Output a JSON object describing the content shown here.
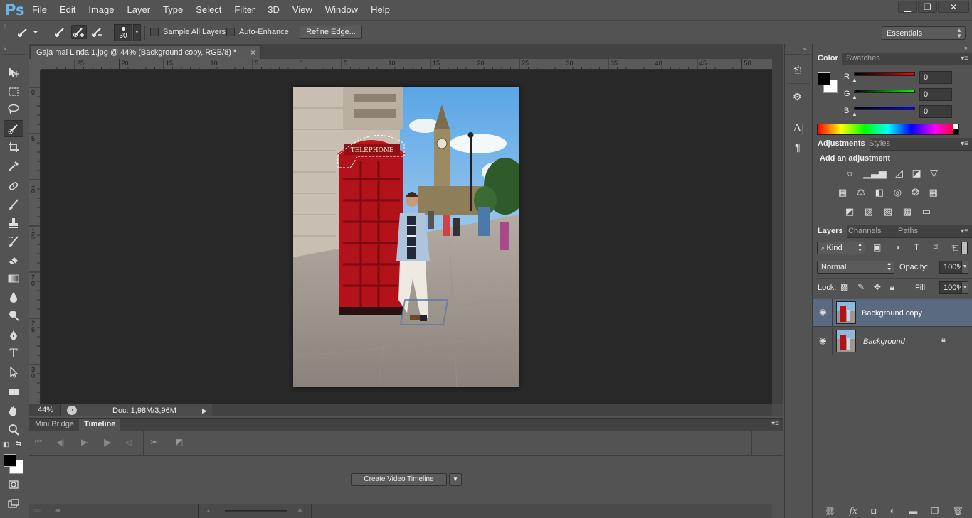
{
  "app": {
    "logo": "Ps"
  },
  "menu": [
    "File",
    "Edit",
    "Image",
    "Layer",
    "Type",
    "Select",
    "Filter",
    "3D",
    "View",
    "Window",
    "Help"
  ],
  "window_controls": {
    "minimize": "▁",
    "restore": "❐",
    "close": "✕"
  },
  "options": {
    "brush_size": "30",
    "sample_all_layers": "Sample All Layers",
    "auto_enhance": "Auto-Enhance",
    "refine_edge": "Refine Edge...",
    "workspace": "Essentials"
  },
  "document": {
    "tab_title": "Gaja mai Linda 1.jpg @ 44% (Background copy, RGB/8) *",
    "close": "×",
    "zoom": "44%",
    "doc_info": "Doc: 1,98M/3,96M",
    "ruler_top": [
      "25",
      "20",
      "15",
      "10",
      "5",
      "0",
      "5",
      "10",
      "15",
      "20",
      "25",
      "30",
      "35",
      "40",
      "45",
      "50"
    ],
    "ruler_left": [
      "0",
      "5",
      "1\n0",
      "1\n5",
      "2\n0",
      "2\n5",
      "3\n0"
    ],
    "photo_sign": "TELEPHONE"
  },
  "timeline": {
    "tabs": [
      "Mini Bridge",
      "Timeline"
    ],
    "create_button": "Create Video Timeline"
  },
  "color_panel": {
    "tabs": [
      "Color",
      "Swatches"
    ],
    "channels": [
      {
        "label": "R",
        "value": "0",
        "gradient_end": "#ff0000"
      },
      {
        "label": "G",
        "value": "0",
        "gradient_end": "#00ff00"
      },
      {
        "label": "B",
        "value": "0",
        "gradient_end": "#0000ff"
      }
    ]
  },
  "adjustments_panel": {
    "tabs": [
      "Adjustments",
      "Styles"
    ],
    "heading": "Add an adjustment"
  },
  "layers_panel": {
    "tabs": [
      "Layers",
      "Channels",
      "Paths"
    ],
    "kind": "Kind",
    "blend_mode": "Normal",
    "opacity_label": "Opacity:",
    "opacity": "100%",
    "lock_label": "Lock:",
    "fill_label": "Fill:",
    "fill": "100%",
    "layers": [
      {
        "name": "Background copy",
        "selected": true,
        "locked": false
      },
      {
        "name": "Background",
        "selected": false,
        "locked": true
      }
    ]
  },
  "colors": {
    "accent_selection": "#5a6a80",
    "phone_red": "#c0141a"
  }
}
